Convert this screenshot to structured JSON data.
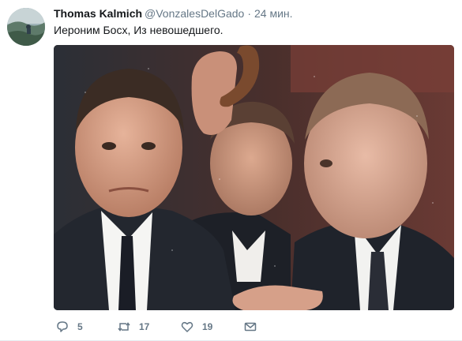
{
  "tweet": {
    "author": {
      "name": "Thomas Kalmich",
      "handle": "@VonzalesDelGado"
    },
    "separator": "·",
    "time": "24 мин.",
    "text": "Иероним Босх, Из невошедшего.",
    "media": {
      "kind": "photo"
    },
    "actions": {
      "reply": {
        "icon": "reply-icon",
        "count": "5"
      },
      "retweet": {
        "icon": "retweet-icon",
        "count": "17"
      },
      "like": {
        "icon": "heart-icon",
        "count": "19"
      },
      "direct_message": {
        "icon": "envelope-icon"
      }
    }
  },
  "colors": {
    "name": "#14171a",
    "secondary": "#657786",
    "icon": "#657786"
  }
}
